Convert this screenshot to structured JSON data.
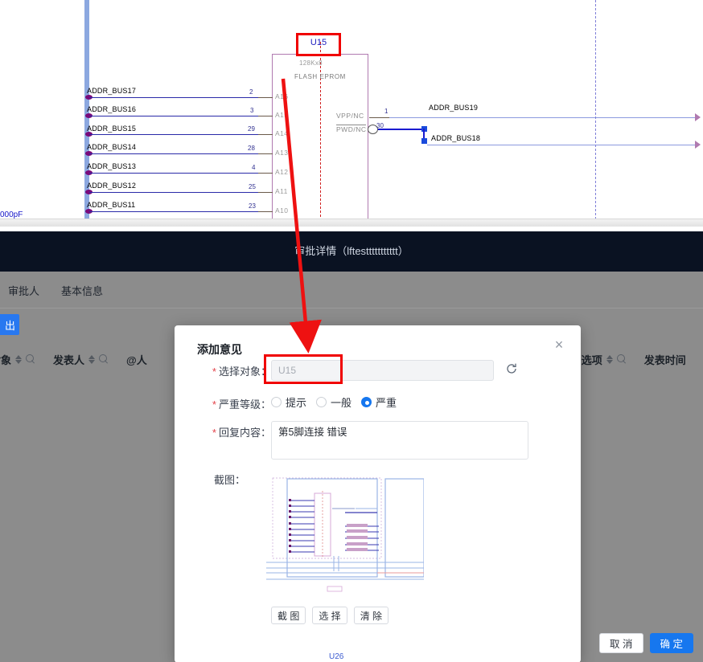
{
  "schematic": {
    "component": {
      "ref": "U15",
      "size_label": "128Kx8",
      "type_label": "FLASH EPROM"
    },
    "left_bus_rows": [
      {
        "net": "ADDR_BUS17",
        "pin_num": "2",
        "pin_name": "A16"
      },
      {
        "net": "ADDR_BUS16",
        "pin_num": "3",
        "pin_name": "A15"
      },
      {
        "net": "ADDR_BUS15",
        "pin_num": "29",
        "pin_name": "A14"
      },
      {
        "net": "ADDR_BUS14",
        "pin_num": "28",
        "pin_name": "A13"
      },
      {
        "net": "ADDR_BUS13",
        "pin_num": "4",
        "pin_name": "A12"
      },
      {
        "net": "ADDR_BUS12",
        "pin_num": "25",
        "pin_name": "A11"
      },
      {
        "net": "ADDR_BUS11",
        "pin_num": "23",
        "pin_name": "A10"
      }
    ],
    "right_pins": [
      {
        "pin_name": "VPP/NC",
        "pin_num": "1",
        "net": "ADDR_BUS19"
      },
      {
        "pin_name": "PWD/NC",
        "pin_num": "30",
        "net": "ADDR_BUS18"
      }
    ],
    "cap_label": "000pF",
    "bottom_ref": "U26"
  },
  "page": {
    "header": {
      "title": "审批详情（lftesttttttttttt）"
    },
    "tabs": [
      {
        "label": "审批人"
      },
      {
        "label": "基本信息"
      }
    ],
    "export_button": "出",
    "table_headers": [
      {
        "label": "对象",
        "sortable": true,
        "searchable": true
      },
      {
        "label": "发表人",
        "sortable": true,
        "searchable": true
      },
      {
        "label": "@人",
        "sortable": false,
        "searchable": false
      },
      {
        "label": "选项",
        "sortable": true,
        "searchable": true
      },
      {
        "label": "发表时间",
        "sortable": false,
        "searchable": false
      }
    ]
  },
  "modal": {
    "title": "添加意见",
    "close_label": "×",
    "fields": {
      "object": {
        "label": "选择对象：",
        "required": true,
        "value": "U15",
        "placeholder": "U15",
        "disabled": true,
        "refresh_icon": "refresh-icon"
      },
      "severity": {
        "label": "严重等级：",
        "required": true,
        "options": [
          {
            "label": "提示",
            "selected": false
          },
          {
            "label": "一般",
            "selected": false
          },
          {
            "label": "严重",
            "selected": true
          }
        ]
      },
      "reply": {
        "label": "回复内容：",
        "required": true,
        "value": "第5脚连接 错误",
        "placeholder": ""
      },
      "screenshot": {
        "label": "截图：",
        "buttons": [
          {
            "label": "截 图"
          },
          {
            "label": "选 择"
          },
          {
            "label": "清 除"
          }
        ]
      }
    },
    "footer": {
      "cancel": "取 消",
      "confirm": "确 定"
    }
  },
  "colors": {
    "accent": "#1677ef",
    "annotation_red": "#f00000",
    "header_bg": "#0a1222",
    "page_bg": "#8c8c8c",
    "wire_blue": "#2a2aa8",
    "required_red": "#e3424a"
  }
}
